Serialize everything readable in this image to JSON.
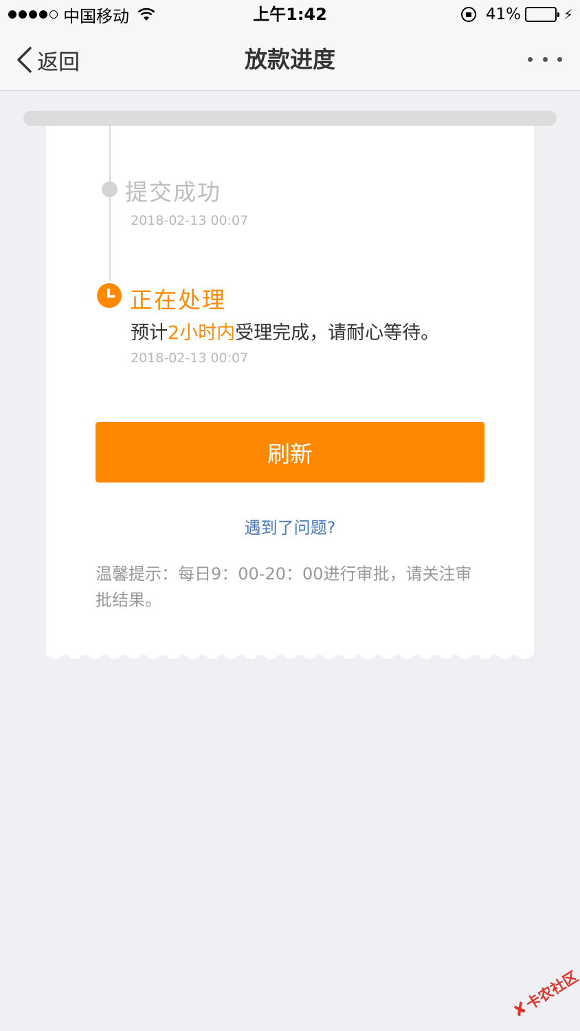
{
  "status_bar": {
    "carrier": "中国移动",
    "time": "上午1:42",
    "battery": "41%",
    "battery_level": 0.41,
    "icons": [
      "signal-dots-icon",
      "wifi-icon",
      "rotation-lock-icon",
      "battery-icon",
      "charging-bolt-icon"
    ]
  },
  "nav": {
    "back_label": "返回",
    "title": "放款进度",
    "more_icon": "more-dots-icon"
  },
  "progress": {
    "steps": [
      {
        "title": "提交成功",
        "time": "2018-02-13 00:07",
        "state": "done",
        "color": "#bdbdbd"
      },
      {
        "title": "正在处理",
        "desc_prefix": "预计",
        "desc_highlight": "2小时内",
        "desc_suffix": "受理完成，请耐心等待。",
        "time": "2018-02-13 00:07",
        "state": "active",
        "color": "#ff8a00"
      }
    ]
  },
  "actions": {
    "refresh_label": "刷新",
    "problem_link": "遇到了问题?"
  },
  "tips": "温馨提示：每日9：00-20：00进行审批，请关注审批结果。",
  "watermark": {
    "text": "卡农社区",
    "color": "#e0332a"
  },
  "colors": {
    "accent": "#ff8800",
    "link": "#4a79b8",
    "background": "#efeff4"
  }
}
